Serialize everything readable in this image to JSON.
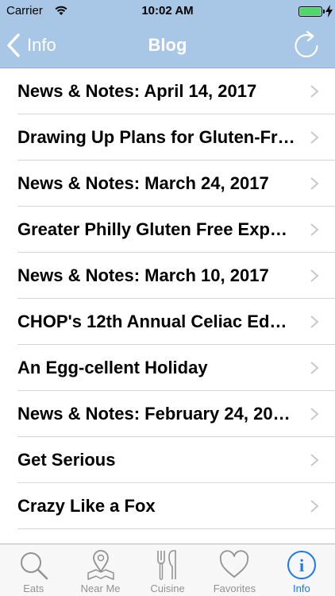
{
  "status_bar": {
    "carrier": "Carrier",
    "time": "10:02 AM",
    "battery_color": "#4cd964"
  },
  "nav": {
    "back_label": "Info",
    "title": "Blog",
    "background": "#a8c6e6",
    "right_icon": "refresh-icon"
  },
  "posts": [
    {
      "title": "News & Notes: April 14, 2017"
    },
    {
      "title": "Drawing Up Plans for Gluten-Fr…"
    },
    {
      "title": "News & Notes: March 24, 2017"
    },
    {
      "title": "Greater Philly Gluten Free Expo…"
    },
    {
      "title": "News & Notes: March 10, 2017"
    },
    {
      "title": "CHOP's 12th Annual Celiac Edu…"
    },
    {
      "title": "An Egg-cellent Holiday"
    },
    {
      "title": "News & Notes: February 24, 20…"
    },
    {
      "title": "Get Serious"
    },
    {
      "title": "Crazy Like a Fox"
    }
  ],
  "tabs": [
    {
      "label": "Eats",
      "icon": "search-icon",
      "active": false
    },
    {
      "label": "Near Me",
      "icon": "location-pin-icon",
      "active": false
    },
    {
      "label": "Cuisine",
      "icon": "utensils-icon",
      "active": false
    },
    {
      "label": "Favorites",
      "icon": "heart-icon",
      "active": false
    },
    {
      "label": "Info",
      "icon": "info-icon",
      "active": true
    }
  ],
  "colors": {
    "accent": "#1878f3",
    "tab_inactive": "#929292"
  }
}
